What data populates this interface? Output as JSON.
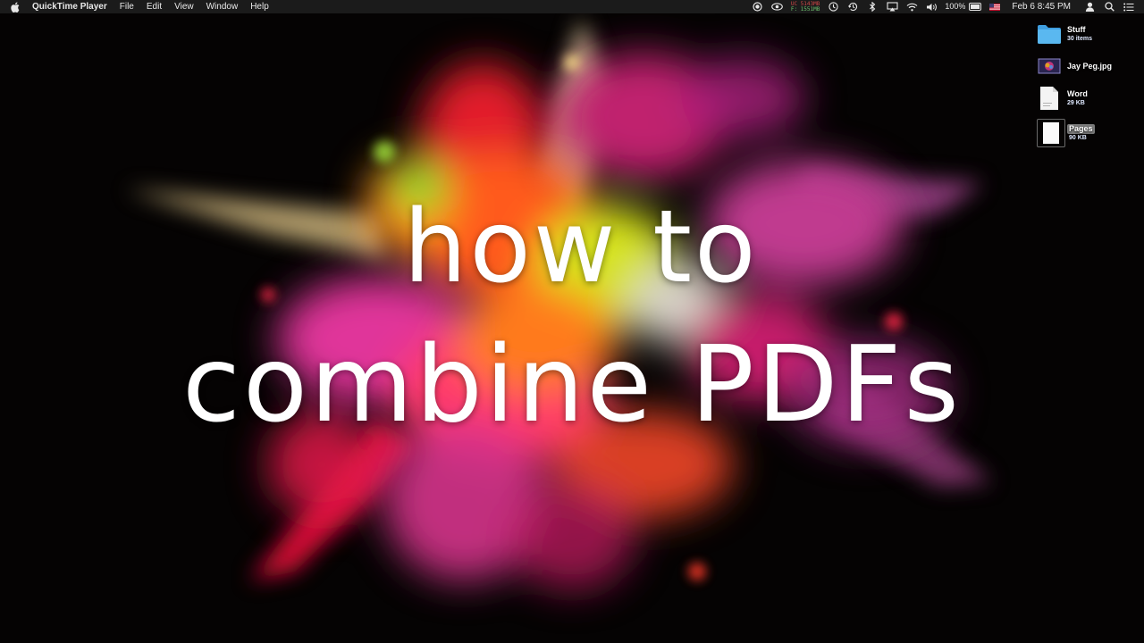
{
  "menubar": {
    "app_name": "QuickTime Player",
    "menus": [
      "File",
      "Edit",
      "View",
      "Window",
      "Help"
    ],
    "memory_top": "UC 5143MB",
    "memory_bottom": "F: 1551MB",
    "battery": "100%",
    "date": "Feb 6",
    "time": "8:45 PM",
    "status_icons": [
      "record-icon",
      "eye-icon",
      "memory-icon",
      "time-machine-icon",
      "clock-icon",
      "bluetooth-icon",
      "airplay-icon",
      "wifi-icon",
      "volume-icon",
      "battery-icon",
      "flag-icon",
      "user-icon",
      "spotlight-icon",
      "notification-center-icon"
    ]
  },
  "desktop": {
    "items": [
      {
        "name": "Stuff",
        "meta": "30 items",
        "icon": "folder-icon"
      },
      {
        "name": "Jay Peg.jpg",
        "meta": "",
        "icon": "image-icon"
      },
      {
        "name": "Word",
        "meta": "29 KB",
        "icon": "word-document-icon"
      },
      {
        "name": "Pages",
        "meta": "90 KB",
        "icon": "pages-document-icon"
      }
    ]
  },
  "overlay": {
    "line1": "how to",
    "line2": "combine PDFs"
  },
  "colors": {
    "background": "#050303",
    "menubar": "#1b1b1b",
    "folder": "#5ab8f0",
    "title_text": "#ffffff"
  }
}
